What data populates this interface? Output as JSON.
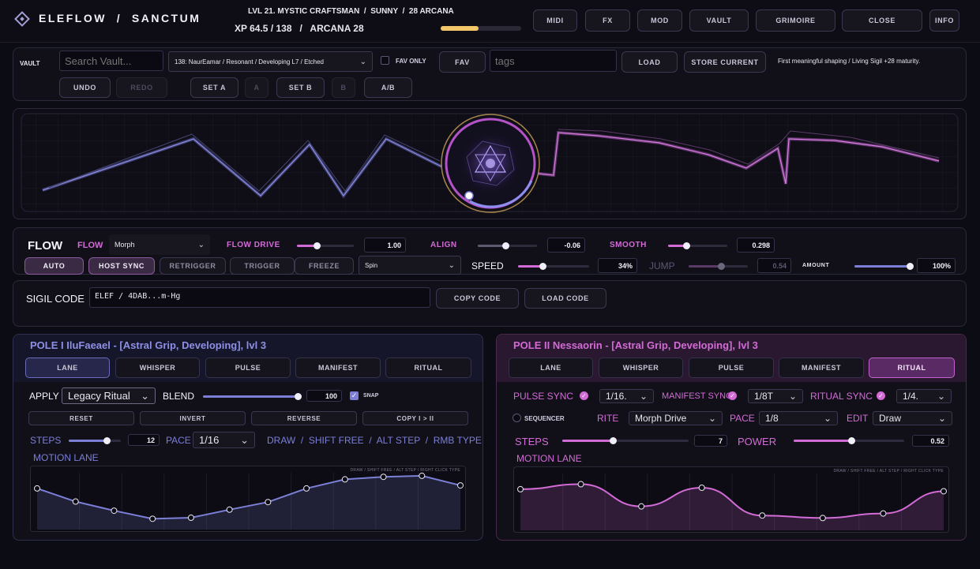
{
  "header": {
    "logo_text": "ELEFLOW  /  SANCTUM",
    "status_line": "LVL 21. MYSTIC CRAFTSMAN  /  SUNNY  /  28 ARCANA",
    "xp_line": "XP 64.5 / 138   /   ARCANA 28",
    "xp_progress": 0.47,
    "nav": [
      "MIDI",
      "FX",
      "MOD",
      "VAULT",
      "GRIMOIRE",
      "CLOSE",
      "INFO"
    ]
  },
  "vault": {
    "label": "VAULT",
    "search_placeholder": "Search Vault...",
    "preset": "138: NaurEamar / Resonant / Developing L7 / Etched",
    "fav_only_label": "FAV ONLY",
    "fav_button": "FAV",
    "tags_placeholder": "tags",
    "load_button": "LOAD",
    "store_button": "STORE CURRENT",
    "status_message": "First meaningful shaping / Living Sigil +28 maturity.",
    "undo": "UNDO",
    "redo": "REDO",
    "set_a": "SET A",
    "a": "A",
    "set_b": "SET B",
    "b": "B",
    "ab": "A/B"
  },
  "flow": {
    "title": "FLOW",
    "flow_label": "FLOW",
    "flow_mode": "Morph",
    "flow_drive_label": "FLOW DRIVE",
    "flow_drive_value": "1.00",
    "flow_drive_level": 0.35,
    "align_label": "ALIGN",
    "align_value": "-0.06",
    "align_level": 0.47,
    "smooth_label": "SMOOTH",
    "smooth_value": "0.298",
    "smooth_level": 0.3,
    "auto": "AUTO",
    "host_sync": "HOST SYNC",
    "retrigger": "RETRIGGER",
    "trigger": "TRIGGER",
    "freeze": "FREEZE",
    "spin_mode": "Spin",
    "speed_label": "SPEED",
    "speed_value": "34%",
    "speed_level": 0.34,
    "jump_label": "JUMP",
    "jump_value": "0.54",
    "jump_level": 0.54,
    "amount_label": "AMOUNT",
    "amount_value": "100%",
    "amount_level": 1.0
  },
  "sigil": {
    "label": "SIGIL CODE",
    "code": "ELEF / 4DAB...m-Hg",
    "copy": "COPY CODE",
    "load": "LOAD CODE"
  },
  "pole1": {
    "title": "POLE I   IluFaeael - [Astral Grip, Developing], lvl 3",
    "tabs": [
      "LANE",
      "WHISPER",
      "PULSE",
      "MANIFEST",
      "RITUAL"
    ],
    "apply_label": "APPLY",
    "apply_value": "Legacy Ritual",
    "blend_label": "BLEND",
    "blend_value": "100",
    "blend_level": 1.0,
    "snap_label": "SNAP",
    "actions": [
      "RESET",
      "INVERT",
      "REVERSE",
      "COPY I > II"
    ],
    "steps_label": "STEPS",
    "steps_value": "12",
    "steps_level": 0.72,
    "pace_label": "PACE",
    "pace_value": "1/16",
    "hint": "DRAW  /  SHIFT FREE  /  ALT STEP  /  RMB TYPE",
    "lane_label": "MOTION LANE",
    "lane_hint": "DRAW / SHIFT FREE / ALT STEP / RIGHT CLICK TYPE",
    "lane_points": [
      0.72,
      0.46,
      0.28,
      0.12,
      0.14,
      0.3,
      0.45,
      0.72,
      0.9,
      0.95,
      0.97,
      0.78
    ]
  },
  "pole2": {
    "title": "POLE II   Nessaorin - [Astral Grip, Developing], lvl 3",
    "tabs": [
      "LANE",
      "WHISPER",
      "PULSE",
      "MANIFEST",
      "RITUAL"
    ],
    "pulse_sync_label": "PULSE SYNC",
    "pulse_sync_value": "1/16.",
    "manifest_sync_label": "MANIFEST SYNC",
    "manifest_sync_value": "1/8T",
    "ritual_sync_label": "RITUAL SYNC",
    "ritual_sync_value": "1/4.",
    "sequencer_label": "SEQUENCER",
    "rite_label": "RITE",
    "rite_value": "Morph Drive",
    "pace_label": "PACE",
    "pace_value": "1/8",
    "edit_label": "EDIT",
    "edit_value": "Draw",
    "steps_label": "STEPS",
    "steps_value": "7",
    "steps_level": 0.4,
    "power_label": "POWER",
    "power_value": "0.52",
    "power_level": 0.52,
    "lane_label": "MOTION LANE",
    "lane_hint": "DRAW / SHIFT FREE / ALT STEP / RIGHT CLICK TYPE",
    "lane_points": [
      0.72,
      0.82,
      0.38,
      0.75,
      0.2,
      0.15,
      0.24,
      0.68
    ]
  },
  "colors": {
    "pink": "#d36bd6",
    "blue": "#7b7fd6",
    "gold": "#e8c36a"
  }
}
